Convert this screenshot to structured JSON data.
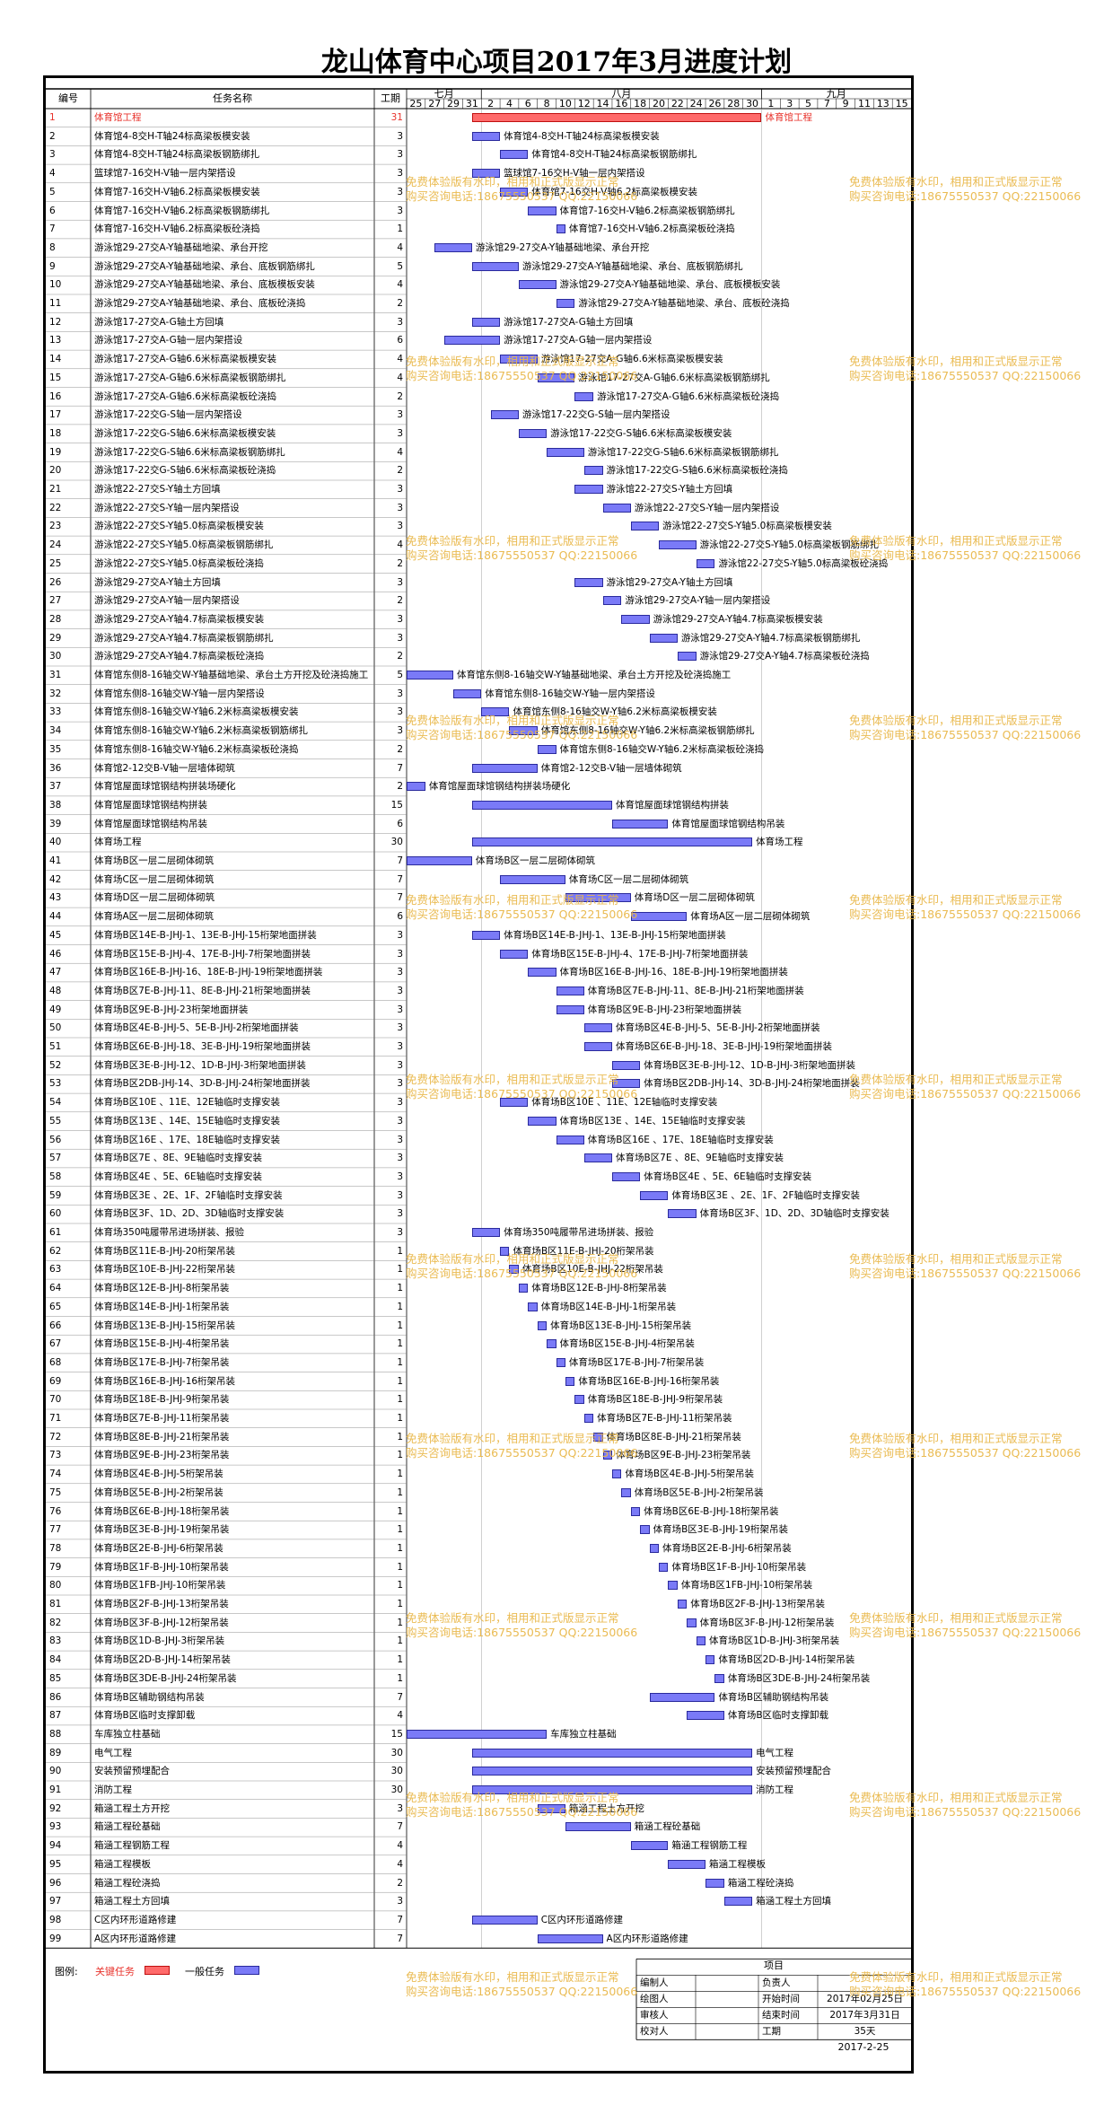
{
  "title": "龙山体育中心项目2017年3月进度计划",
  "headers": {
    "id": "编号",
    "name": "任务名称",
    "dur": "工期"
  },
  "months": [
    "七月",
    "八月",
    "九月"
  ],
  "days": [
    "25",
    "27",
    "29",
    "31",
    "2",
    "4",
    "6",
    "8",
    "10",
    "12",
    "14",
    "16",
    "18",
    "20",
    "22",
    "24",
    "26",
    "28",
    "30",
    "1",
    "3",
    "5",
    "7",
    "9",
    "11",
    "13",
    "15"
  ],
  "tasks": [
    {
      "id": "1",
      "name": "体育馆工程",
      "dur": "31",
      "start": 4,
      "critical": true
    },
    {
      "id": "2",
      "name": "体育馆4-8交H-T轴24标高梁板模安装",
      "dur": "3",
      "start": 4
    },
    {
      "id": "3",
      "name": "体育馆4-8交H-T轴24标高梁板钢筋绑扎",
      "dur": "3",
      "start": 7
    },
    {
      "id": "4",
      "name": "篮球馆7-16交H-V轴一层内架搭设",
      "dur": "3",
      "start": 4
    },
    {
      "id": "5",
      "name": "体育馆7-16交H-V轴6.2标高梁板模安装",
      "dur": "3",
      "start": 7
    },
    {
      "id": "6",
      "name": "体育馆7-16交H-V轴6.2标高梁板钢筋绑扎",
      "dur": "3",
      "start": 10
    },
    {
      "id": "7",
      "name": "体育馆7-16交H-V轴6.2标高梁板砼浇捣",
      "dur": "1",
      "start": 13
    },
    {
      "id": "8",
      "name": "游泳馆29-27交A-Y轴基础地梁、承台开挖",
      "dur": "4",
      "start": 0
    },
    {
      "id": "9",
      "name": "游泳馆29-27交A-Y轴基础地梁、承台、底板钢筋绑扎",
      "dur": "5",
      "start": 4
    },
    {
      "id": "10",
      "name": "游泳馆29-27交A-Y轴基础地梁、承台、底板模板安装",
      "dur": "4",
      "start": 9
    },
    {
      "id": "11",
      "name": "游泳馆29-27交A-Y轴基础地梁、承台、底板砼浇捣",
      "dur": "2",
      "start": 13
    },
    {
      "id": "12",
      "name": "游泳馆17-27交A-G轴土方回填",
      "dur": "3",
      "start": 4
    },
    {
      "id": "13",
      "name": "游泳馆17-27交A-G轴一层内架搭设",
      "dur": "6",
      "start": 1
    },
    {
      "id": "14",
      "name": "游泳馆17-27交A-G轴6.6米标高梁板模安装",
      "dur": "4",
      "start": 7
    },
    {
      "id": "15",
      "name": "游泳馆17-27交A-G轴6.6米标高梁板钢筋绑扎",
      "dur": "4",
      "start": 11
    },
    {
      "id": "16",
      "name": "游泳馆17-27交A-G轴6.6米标高梁板砼浇捣",
      "dur": "2",
      "start": 15
    },
    {
      "id": "17",
      "name": "游泳馆17-22交G-S轴一层内架搭设",
      "dur": "3",
      "start": 6
    },
    {
      "id": "18",
      "name": "游泳馆17-22交G-S轴6.6米标高梁板模安装",
      "dur": "3",
      "start": 9
    },
    {
      "id": "19",
      "name": "游泳馆17-22交G-S轴6.6米标高梁板钢筋绑扎",
      "dur": "4",
      "start": 12
    },
    {
      "id": "20",
      "name": "游泳馆17-22交G-S轴6.6米标高梁板砼浇捣",
      "dur": "2",
      "start": 16
    },
    {
      "id": "21",
      "name": "游泳馆22-27交S-Y轴土方回填",
      "dur": "3",
      "start": 15
    },
    {
      "id": "22",
      "name": "游泳馆22-27交S-Y轴一层内架搭设",
      "dur": "3",
      "start": 18
    },
    {
      "id": "23",
      "name": "游泳馆22-27交S-Y轴5.0标高梁板模安装",
      "dur": "3",
      "start": 21
    },
    {
      "id": "24",
      "name": "游泳馆22-27交S-Y轴5.0标高梁板钢筋绑扎",
      "dur": "4",
      "start": 24
    },
    {
      "id": "25",
      "name": "游泳馆22-27交S-Y轴5.0标高梁板砼浇捣",
      "dur": "2",
      "start": 28
    },
    {
      "id": "26",
      "name": "游泳馆29-27交A-Y轴土方回填",
      "dur": "3",
      "start": 15
    },
    {
      "id": "27",
      "name": "游泳馆29-27交A-Y轴一层内架搭设",
      "dur": "2",
      "start": 18
    },
    {
      "id": "28",
      "name": "游泳馆29-27交A-Y轴4.7标高梁板模安装",
      "dur": "3",
      "start": 20
    },
    {
      "id": "29",
      "name": "游泳馆29-27交A-Y轴4.7标高梁板钢筋绑扎",
      "dur": "3",
      "start": 23
    },
    {
      "id": "30",
      "name": "游泳馆29-27交A-Y轴4.7标高梁板砼浇捣",
      "dur": "2",
      "start": 26
    },
    {
      "id": "31",
      "name": "体育馆东侧8-16轴交W-Y轴基础地梁、承台土方开挖及砼浇捣施工",
      "dur": "5",
      "start": -3
    },
    {
      "id": "32",
      "name": "体育馆东侧8-16轴交W-Y轴一层内架搭设",
      "dur": "3",
      "start": 2
    },
    {
      "id": "33",
      "name": "体育馆东侧8-16轴交W-Y轴6.2米标高梁板模安装",
      "dur": "3",
      "start": 5
    },
    {
      "id": "34",
      "name": "体育馆东侧8-16轴交W-Y轴6.2米标高梁板钢筋绑扎",
      "dur": "3",
      "start": 8
    },
    {
      "id": "35",
      "name": "体育馆东侧8-16轴交W-Y轴6.2米标高梁板砼浇捣",
      "dur": "2",
      "start": 11
    },
    {
      "id": "36",
      "name": "体育馆2-12交B-V轴一层墙体砌筑",
      "dur": "7",
      "start": 4
    },
    {
      "id": "37",
      "name": "体育馆屋面球馆钢结构拼装场硬化",
      "dur": "2",
      "start": -3
    },
    {
      "id": "38",
      "name": "体育馆屋面球馆钢结构拼装",
      "dur": "15",
      "start": 4
    },
    {
      "id": "39",
      "name": "体育馆屋面球馆钢结构吊装",
      "dur": "6",
      "start": 19
    },
    {
      "id": "40",
      "name": "体育场工程",
      "dur": "30",
      "start": 4
    },
    {
      "id": "41",
      "name": "体育场B区一层二层砌体砌筑",
      "dur": "7",
      "start": -3
    },
    {
      "id": "42",
      "name": "体育场C区一层二层砌体砌筑",
      "dur": "7",
      "start": 7
    },
    {
      "id": "43",
      "name": "体育场D区一层二层砌体砌筑",
      "dur": "7",
      "start": 14
    },
    {
      "id": "44",
      "name": "体育场A区一层二层砌体砌筑",
      "dur": "6",
      "start": 21
    },
    {
      "id": "45",
      "name": "体育场B区14E-B-JHJ-1、13E-B-JHJ-15桁架地面拼装",
      "dur": "3",
      "start": 4
    },
    {
      "id": "46",
      "name": "体育场B区15E-B-JHJ-4、17E-B-JHJ-7桁架地面拼装",
      "dur": "3",
      "start": 7
    },
    {
      "id": "47",
      "name": "体育场B区16E-B-JHJ-16、18E-B-JHJ-19桁架地面拼装",
      "dur": "3",
      "start": 10
    },
    {
      "id": "48",
      "name": "体育场B区7E-B-JHJ-11、8E-B-JHJ-21桁架地面拼装",
      "dur": "3",
      "start": 13
    },
    {
      "id": "49",
      "name": "体育场B区9E-B-JHJ-23桁架地面拼装",
      "dur": "3",
      "start": 13
    },
    {
      "id": "50",
      "name": "体育场B区4E-B-JHJ-5、5E-B-JHJ-2桁架地面拼装",
      "dur": "3",
      "start": 16
    },
    {
      "id": "51",
      "name": "体育场B区6E-B-JHJ-18、3E-B-JHJ-19桁架地面拼装",
      "dur": "3",
      "start": 16
    },
    {
      "id": "52",
      "name": "体育场B区3E-B-JHJ-12、1D-B-JHJ-3桁架地面拼装",
      "dur": "3",
      "start": 19
    },
    {
      "id": "53",
      "name": "体育场B区2DB-JHJ-14、3D-B-JHJ-24桁架地面拼装",
      "dur": "3",
      "start": 19
    },
    {
      "id": "54",
      "name": "体育场B区10E 、11E、12E轴临时支撑安装",
      "dur": "3",
      "start": 7
    },
    {
      "id": "55",
      "name": "体育场B区13E 、14E、15E轴临时支撑安装",
      "dur": "3",
      "start": 10
    },
    {
      "id": "56",
      "name": "体育场B区16E 、17E、18E轴临时支撑安装",
      "dur": "3",
      "start": 13
    },
    {
      "id": "57",
      "name": "体育场B区7E 、8E、9E轴临时支撑安装",
      "dur": "3",
      "start": 16
    },
    {
      "id": "58",
      "name": "体育场B区4E 、5E、6E轴临时支撑安装",
      "dur": "3",
      "start": 19
    },
    {
      "id": "59",
      "name": "体育场B区3E 、2E、1F、2F轴临时支撑安装",
      "dur": "3",
      "start": 22
    },
    {
      "id": "60",
      "name": "体育场B区3F、1D、2D、3D轴临时支撑安装",
      "dur": "3",
      "start": 25
    },
    {
      "id": "61",
      "name": "体育场350吨履带吊进场拼装、报验",
      "dur": "3",
      "start": 4
    },
    {
      "id": "62",
      "name": "体育场B区11E-B-JHJ-20桁架吊装",
      "dur": "1",
      "start": 7
    },
    {
      "id": "63",
      "name": "体育场B区10E-B-JHJ-22桁架吊装",
      "dur": "1",
      "start": 8
    },
    {
      "id": "64",
      "name": "体育场B区12E-B-JHJ-8桁架吊装",
      "dur": "1",
      "start": 9
    },
    {
      "id": "65",
      "name": "体育场B区14E-B-JHJ-1桁架吊装",
      "dur": "1",
      "start": 10
    },
    {
      "id": "66",
      "name": "体育场B区13E-B-JHJ-15桁架吊装",
      "dur": "1",
      "start": 11
    },
    {
      "id": "67",
      "name": "体育场B区15E-B-JHJ-4桁架吊装",
      "dur": "1",
      "start": 12
    },
    {
      "id": "68",
      "name": "体育场B区17E-B-JHJ-7桁架吊装",
      "dur": "1",
      "start": 13
    },
    {
      "id": "69",
      "name": "体育场B区16E-B-JHJ-16桁架吊装",
      "dur": "1",
      "start": 14
    },
    {
      "id": "70",
      "name": "体育场B区18E-B-JHJ-9桁架吊装",
      "dur": "1",
      "start": 15
    },
    {
      "id": "71",
      "name": "体育场B区7E-B-JHJ-11桁架吊装",
      "dur": "1",
      "start": 16
    },
    {
      "id": "72",
      "name": "体育场B区8E-B-JHJ-21桁架吊装",
      "dur": "1",
      "start": 17
    },
    {
      "id": "73",
      "name": "体育场B区9E-B-JHJ-23桁架吊装",
      "dur": "1",
      "start": 18
    },
    {
      "id": "74",
      "name": "体育场B区4E-B-JHJ-5桁架吊装",
      "dur": "1",
      "start": 19
    },
    {
      "id": "75",
      "name": "体育场B区5E-B-JHJ-2桁架吊装",
      "dur": "1",
      "start": 20
    },
    {
      "id": "76",
      "name": "体育场B区6E-B-JHJ-18桁架吊装",
      "dur": "1",
      "start": 21
    },
    {
      "id": "77",
      "name": "体育场B区3E-B-JHJ-19桁架吊装",
      "dur": "1",
      "start": 22
    },
    {
      "id": "78",
      "name": "体育场B区2E-B-JHJ-6桁架吊装",
      "dur": "1",
      "start": 23
    },
    {
      "id": "79",
      "name": "体育场B区1F-B-JHJ-10桁架吊装",
      "dur": "1",
      "start": 24
    },
    {
      "id": "80",
      "name": "体育场B区1FB-JHJ-10桁架吊装",
      "dur": "1",
      "start": 25
    },
    {
      "id": "81",
      "name": "体育场B区2F-B-JHJ-13桁架吊装",
      "dur": "1",
      "start": 26
    },
    {
      "id": "82",
      "name": "体育场B区3F-B-JHJ-12桁架吊装",
      "dur": "1",
      "start": 27
    },
    {
      "id": "83",
      "name": "体育场B区1D-B-JHJ-3桁架吊装",
      "dur": "1",
      "start": 28
    },
    {
      "id": "84",
      "name": "体育场B区2D-B-JHJ-14桁架吊装",
      "dur": "1",
      "start": 29
    },
    {
      "id": "85",
      "name": "体育场B区3DE-B-JHJ-24桁架吊装",
      "dur": "1",
      "start": 30
    },
    {
      "id": "86",
      "name": "体育场B区辅助钢结构吊装",
      "dur": "7",
      "start": 23
    },
    {
      "id": "87",
      "name": "体育场B区临时支撑卸载",
      "dur": "4",
      "start": 27
    },
    {
      "id": "88",
      "name": "车库独立柱基础",
      "dur": "15",
      "start": -3
    },
    {
      "id": "89",
      "name": "电气工程",
      "dur": "30",
      "start": 4
    },
    {
      "id": "90",
      "name": "安装预留预埋配合",
      "dur": "30",
      "start": 4
    },
    {
      "id": "91",
      "name": "消防工程",
      "dur": "30",
      "start": 4
    },
    {
      "id": "92",
      "name": "箱涵工程土方开挖",
      "dur": "3",
      "start": 11
    },
    {
      "id": "93",
      "name": "箱涵工程砼基础",
      "dur": "7",
      "start": 14
    },
    {
      "id": "94",
      "name": "箱涵工程钢筋工程",
      "dur": "4",
      "start": 21
    },
    {
      "id": "95",
      "name": "箱涵工程模板",
      "dur": "4",
      "start": 25
    },
    {
      "id": "96",
      "name": "箱涵工程砼浇捣",
      "dur": "2",
      "start": 29
    },
    {
      "id": "97",
      "name": "箱涵工程土方回填",
      "dur": "3",
      "start": 31
    },
    {
      "id": "98",
      "name": "C区内环形道路修建",
      "dur": "7",
      "start": 4
    },
    {
      "id": "99",
      "name": "A区内环形道路修建",
      "dur": "7",
      "start": 11
    }
  ],
  "legend": {
    "label": "图例:",
    "critical": "关键任务",
    "normal": "一般任务"
  },
  "colors": {
    "critical": "#ff6a6a",
    "normal": "#7a7af7",
    "watermark": "#e9b84a"
  },
  "info": {
    "project_label": "项目",
    "rows": [
      {
        "k1": "编制人",
        "v1": "",
        "k2": "负责人",
        "v2": ""
      },
      {
        "k1": "绘图人",
        "v1": "",
        "k2": "开始时间",
        "v2": "2017年02月25日"
      },
      {
        "k1": "审核人",
        "v1": "",
        "k2": "结束时间",
        "v2": "2017年3月31日"
      },
      {
        "k1": "校对人",
        "v1": "",
        "k2": "工期",
        "v2": "35天"
      }
    ],
    "date": "2017-2-25"
  },
  "watermark": {
    "line1": "免费体验版有水印，相用和正式版显示正常",
    "line2": "购买咨询电话:18675550537 QQ:22150066"
  }
}
